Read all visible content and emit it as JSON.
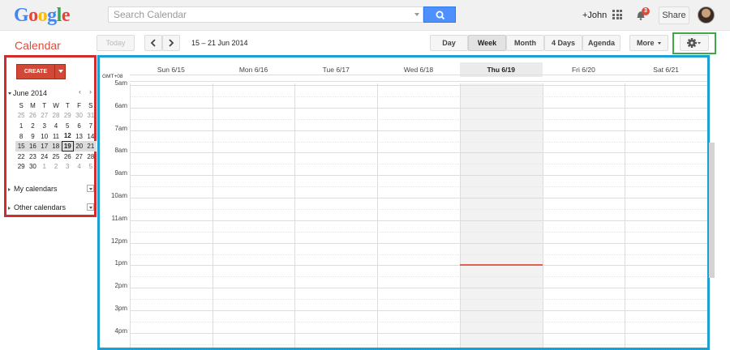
{
  "logo": {
    "text": "Google",
    "letters": [
      "G",
      "o",
      "o",
      "g",
      "l",
      "e"
    ],
    "colors": [
      "#4285f4",
      "#ea4335",
      "#fbbc05",
      "#4285f4",
      "#34a853",
      "#ea4335"
    ]
  },
  "search": {
    "placeholder": "Search Calendar"
  },
  "user": {
    "name": "+John",
    "notification_count": "3",
    "share_label": "Share"
  },
  "app": {
    "title": "Calendar"
  },
  "toolbar": {
    "today_label": "Today",
    "date_range": "15 – 21 Jun 2014",
    "views": [
      "Day",
      "Week",
      "Month",
      "4 Days",
      "Agenda"
    ],
    "selected_view": "Week",
    "more_label": "More"
  },
  "sidebar": {
    "create_label": "CREATE",
    "month_label": "June 2014",
    "weekday_headers": [
      "S",
      "M",
      "T",
      "W",
      "T",
      "F",
      "S"
    ],
    "weeks": [
      [
        "25",
        "26",
        "27",
        "28",
        "29",
        "30",
        "31"
      ],
      [
        "1",
        "2",
        "3",
        "4",
        "5",
        "6",
        "7"
      ],
      [
        "8",
        "9",
        "10",
        "11",
        "12",
        "13",
        "14"
      ],
      [
        "15",
        "16",
        "17",
        "18",
        "19",
        "20",
        "21"
      ],
      [
        "22",
        "23",
        "24",
        "25",
        "26",
        "27",
        "28"
      ],
      [
        "29",
        "30",
        "1",
        "2",
        "3",
        "4",
        "5"
      ]
    ],
    "current_week_index": 3,
    "today": "19",
    "sections": [
      "My calendars",
      "Other calendars"
    ]
  },
  "calendar": {
    "timezone": "GMT+08",
    "days": [
      "Sun 6/15",
      "Mon 6/16",
      "Tue 6/17",
      "Wed 6/18",
      "Thu 6/19",
      "Fri 6/20",
      "Sat 6/21"
    ],
    "today_index": 4,
    "hours": [
      "5am",
      "6am",
      "7am",
      "8am",
      "9am",
      "10am",
      "11am",
      "12pm",
      "1pm",
      "2pm",
      "3pm",
      "4pm"
    ],
    "current_time_hours": 13.0
  },
  "colors": {
    "accent_red": "#dd4b39",
    "search_blue": "#4d90fe",
    "highlight_red": "#d12b2b",
    "highlight_blue": "#1c9fd1",
    "highlight_green": "#3da948"
  }
}
